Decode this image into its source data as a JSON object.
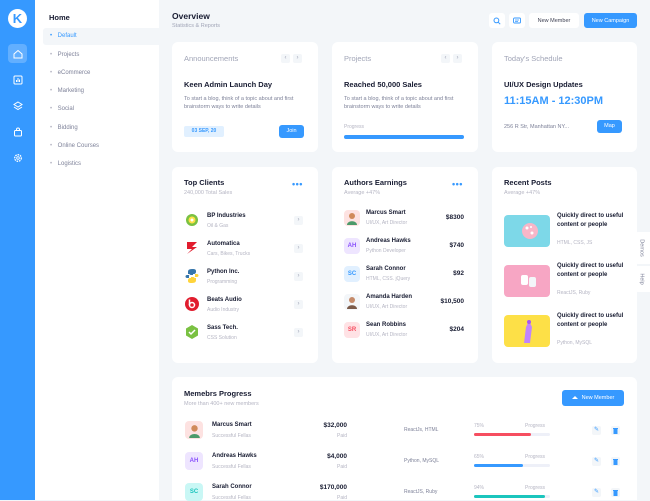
{
  "rail": {
    "logo": "K",
    "icons": [
      "home-icon",
      "chart-icon",
      "layers-icon",
      "shop-icon",
      "settings-icon"
    ]
  },
  "aside": {
    "title": "Home",
    "items": [
      {
        "label": "Default",
        "active": true
      },
      {
        "label": "Projects"
      },
      {
        "label": "eCommerce"
      },
      {
        "label": "Marketing"
      },
      {
        "label": "Social"
      },
      {
        "label": "Bidding"
      },
      {
        "label": "Online Courses"
      },
      {
        "label": "Logistics"
      }
    ]
  },
  "header": {
    "title": "Overview",
    "subtitle": "Statistics & Reports",
    "new_member": "New Member",
    "new_campaign": "New Campaign"
  },
  "announcements": {
    "title": "Announcements",
    "heading": "Keen Admin Launch Day",
    "text": "To start a blog, think of a topic about and first brainstorm ways to write details",
    "date": "03 SEP, 20",
    "button": "Join"
  },
  "projects": {
    "title": "Projects",
    "heading": "Reached 50,000 Sales",
    "text": "To start a blog, think of a topic about and first brainstorm ways to write details",
    "progress_label": "Progress",
    "progress": 1.0
  },
  "schedule": {
    "title": "Today's Schedule",
    "heading": "UI/UX Design Updates",
    "time": "11:15AM - 12:30PM",
    "address": "256 R Str, Manhattan NY...",
    "button": "Map"
  },
  "clients": {
    "title": "Top Clients",
    "subtitle": "240,000 Total Sales",
    "items": [
      {
        "name": "BP Industries",
        "desc": "Oil & Gas"
      },
      {
        "name": "Automatica",
        "desc": "Cars, Bikes, Trucks"
      },
      {
        "name": "Python Inc.",
        "desc": "Programming"
      },
      {
        "name": "Beats Audio",
        "desc": "Audio Industry"
      },
      {
        "name": "Sass Tech.",
        "desc": "CSS Solution"
      }
    ]
  },
  "authors": {
    "title": "Authors Earnings",
    "subtitle": "Average +47%",
    "items": [
      {
        "initials": "",
        "name": "Marcus Smart",
        "role": "UI/UX, Art Director",
        "amount": "$8300"
      },
      {
        "initials": "AH",
        "name": "Andreas Hawks",
        "role": "Python Developer",
        "amount": "$740"
      },
      {
        "initials": "SC",
        "name": "Sarah Connor",
        "role": "HTML, CSS. jQuery",
        "amount": "$92"
      },
      {
        "initials": "",
        "name": "Amanda Harden",
        "role": "UI/UX, Art Director",
        "amount": "$10,500"
      },
      {
        "initials": "SR",
        "name": "Sean Robbins",
        "role": "UI/UX, Art Director",
        "amount": "$204"
      }
    ]
  },
  "posts": {
    "title": "Recent Posts",
    "subtitle": "Average +47%",
    "items": [
      {
        "title": "Quickly direct to useful content or people",
        "tags": "HTML, CSS, JS"
      },
      {
        "title": "Quickly direct to useful content or people",
        "tags": "ReactJS, Ruby"
      },
      {
        "title": "Quickly direct to useful content or people",
        "tags": "Python, MySQL"
      }
    ]
  },
  "members": {
    "title": "Memebrs Progress",
    "subtitle": "More than 400+ new members",
    "button": "New Member",
    "rows": [
      {
        "initials": "",
        "name": "Marcus Smart",
        "role": "Successful Fellas",
        "amount": "$32,000",
        "status": "Paid",
        "tech": "ReactJs, HTML",
        "pct": "75%",
        "progress": 0.75,
        "label": "Progress",
        "color": "#f64e60"
      },
      {
        "initials": "AH",
        "name": "Andreas Hawks",
        "role": "Successful Fellas",
        "amount": "$4,000",
        "status": "Paid",
        "tech": "Python, MySQL",
        "pct": "65%",
        "progress": 0.65,
        "label": "Progress",
        "color": "#3699ff"
      },
      {
        "initials": "SC",
        "name": "Sarah Connor",
        "role": "Successful Fellas",
        "amount": "$170,000",
        "status": "Paid",
        "tech": "ReactJS, Ruby",
        "pct": "94%",
        "progress": 0.94,
        "label": "Progress",
        "color": "#1bc5bd"
      }
    ]
  },
  "side_tabs": {
    "demos": "Demos",
    "help": "Help"
  },
  "colors": {
    "primary": "#3699ff",
    "danger": "#f64e60",
    "success": "#1bc5bd"
  }
}
